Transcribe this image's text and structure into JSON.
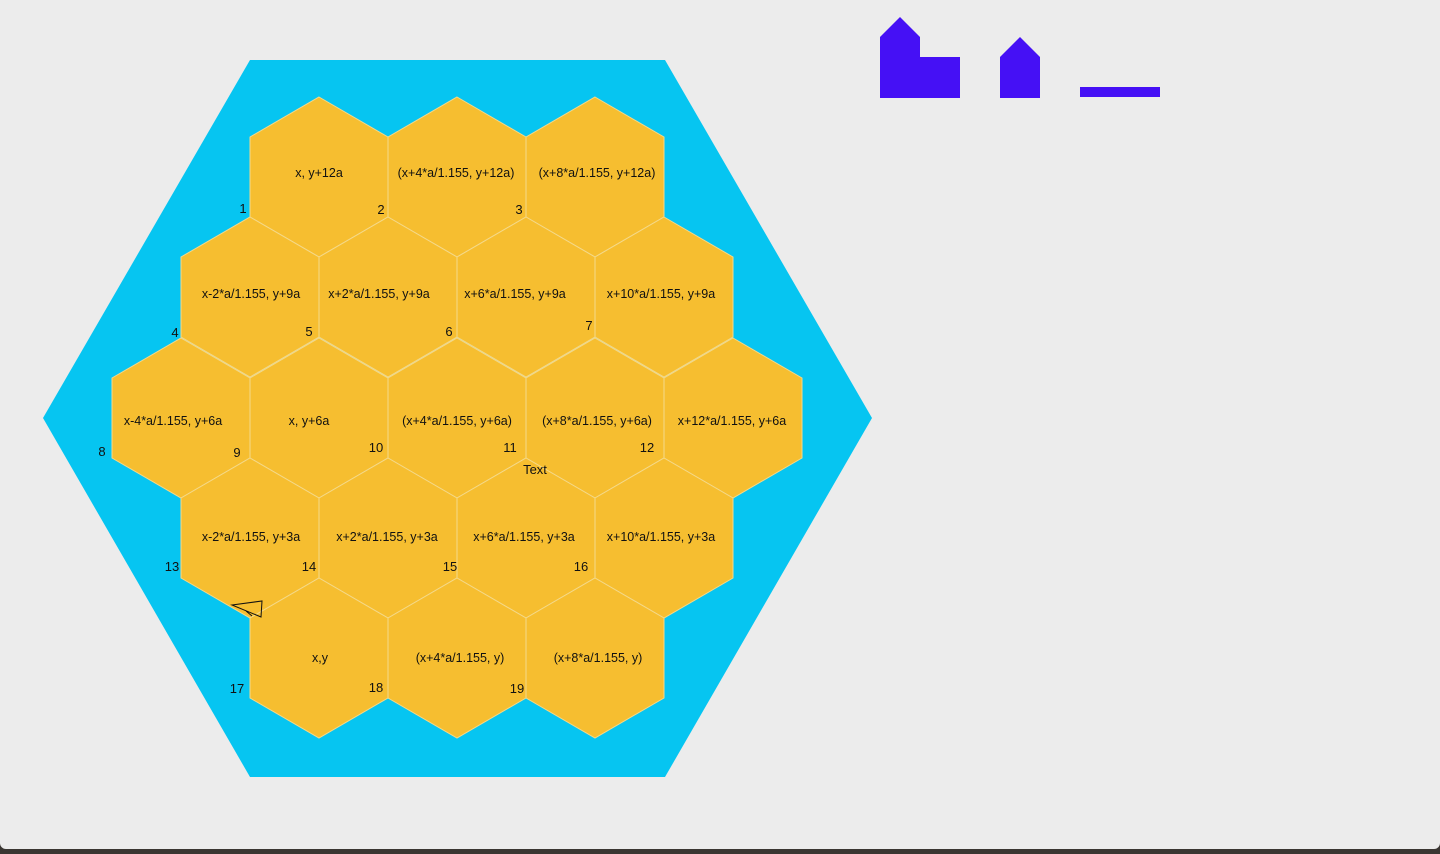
{
  "colors": {
    "background": "#ececec",
    "sea": "#06c5f1",
    "tile": "#f6be30",
    "tile_border": "#f4d98a",
    "pieces": "#4510f5"
  },
  "tiles": [
    {
      "id": "tile-1",
      "label": "x, y+12a"
    },
    {
      "id": "tile-2",
      "label": "(x+4*a/1.155, y+12a)"
    },
    {
      "id": "tile-3",
      "label": "(x+8*a/1.155, y+12a)"
    },
    {
      "id": "tile-4",
      "label": "x-2*a/1.155, y+9a"
    },
    {
      "id": "tile-5",
      "label": "x+2*a/1.155, y+9a"
    },
    {
      "id": "tile-6",
      "label": "x+6*a/1.155, y+9a"
    },
    {
      "id": "tile-7",
      "label": "x+10*a/1.155, y+9a"
    },
    {
      "id": "tile-8",
      "label": "x-4*a/1.155, y+6a"
    },
    {
      "id": "tile-9",
      "label": "x, y+6a"
    },
    {
      "id": "tile-10",
      "label": "(x+4*a/1.155, y+6a)"
    },
    {
      "id": "tile-11",
      "label": "(x+8*a/1.155, y+6a)"
    },
    {
      "id": "tile-12",
      "label": "x+12*a/1.155, y+6a"
    },
    {
      "id": "tile-13",
      "label": "x-2*a/1.155, y+3a"
    },
    {
      "id": "tile-14",
      "label": "x+2*a/1.155, y+3a"
    },
    {
      "id": "tile-15",
      "label": "x+6*a/1.155, y+3a"
    },
    {
      "id": "tile-16",
      "label": "x+10*a/1.155, y+3a"
    },
    {
      "id": "tile-17",
      "label": "x,y"
    },
    {
      "id": "tile-18",
      "label": "(x+4*a/1.155, y)"
    },
    {
      "id": "tile-19",
      "label": "(x+8*a/1.155, y)"
    }
  ],
  "numbers": [
    "1",
    "2",
    "3",
    "4",
    "5",
    "6",
    "7",
    "8",
    "9",
    "10",
    "11",
    "12",
    "13",
    "14",
    "15",
    "16",
    "17",
    "18",
    "19"
  ],
  "free_text": "Text",
  "pieces": [
    {
      "id": "city-piece",
      "icon": "city-icon"
    },
    {
      "id": "settlement-piece",
      "icon": "house-icon"
    },
    {
      "id": "road-piece",
      "icon": "road-icon"
    }
  ]
}
